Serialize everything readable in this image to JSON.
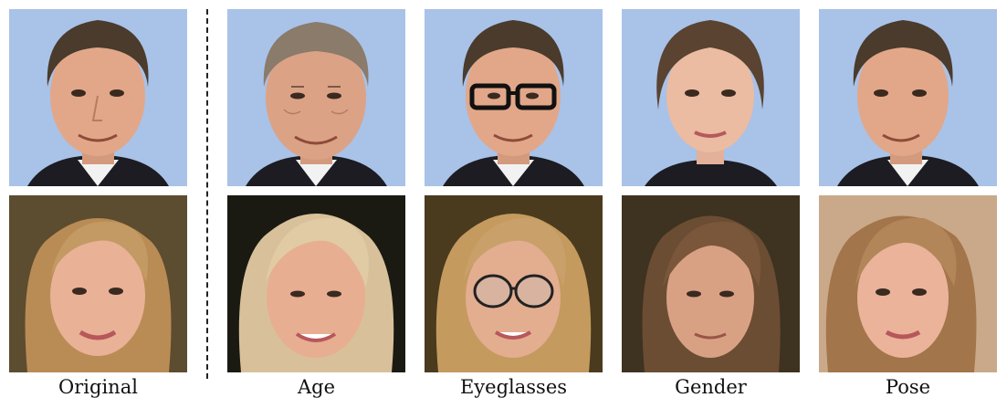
{
  "columns": [
    {
      "label": "Original"
    },
    {
      "label": "Age"
    },
    {
      "label": "Eyeglasses"
    },
    {
      "label": "Gender"
    },
    {
      "label": "Pose"
    }
  ],
  "rows": [
    {
      "subject": "man",
      "background_color": "#a8c1e6",
      "hair_color": "#4a3b2c",
      "skin_color": "#e2a789",
      "cells": [
        "original",
        "age",
        "eyeglasses",
        "gender",
        "pose"
      ]
    },
    {
      "subject": "woman",
      "background_color": "#5a4a2e",
      "hair_color": "#b98c55",
      "skin_color": "#e9b196",
      "cells": [
        "original",
        "age",
        "eyeglasses",
        "gender",
        "pose"
      ]
    }
  ],
  "colors": {
    "eyeglasses_frame": "#111111",
    "aged_hair": "#8a7b6b",
    "aged_hair_blonde": "#d8c19a",
    "gender_hair_dark": "#5a4330"
  }
}
